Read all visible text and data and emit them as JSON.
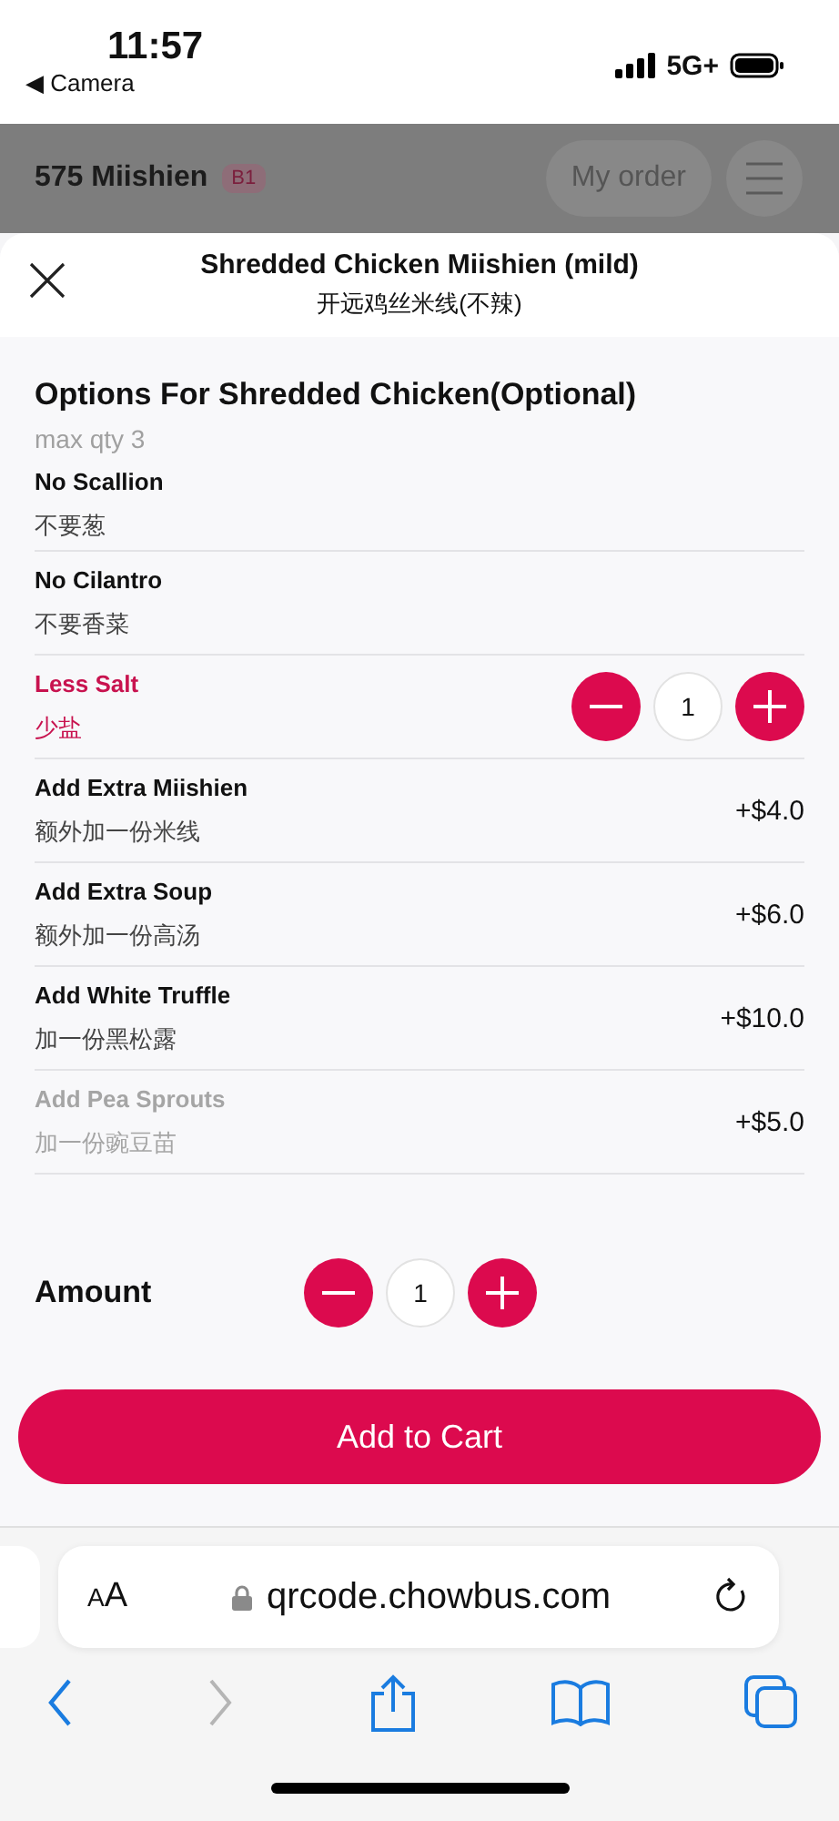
{
  "status_bar": {
    "time": "11:57",
    "back_label": "◀ Camera",
    "network": "5G+"
  },
  "header": {
    "restaurant": "575 Miishien",
    "table_badge": "B1",
    "my_order": "My order"
  },
  "sheet": {
    "title": "Shredded Chicken Miishien (mild)",
    "subtitle": "开远鸡丝米线(不辣)"
  },
  "options_group": {
    "title": "Options For Shredded Chicken(Optional)",
    "note": "max qty 3",
    "options": [
      {
        "kind": "plain",
        "name": "No Scallion",
        "name_cn": "不要葱",
        "selected": false,
        "disabled": false
      },
      {
        "kind": "plain",
        "name": "No Cilantro",
        "name_cn": "不要香菜",
        "selected": false,
        "disabled": false
      },
      {
        "kind": "stepper",
        "name": "Less Salt",
        "name_cn": "少盐",
        "selected": true,
        "disabled": false,
        "quantity": "1"
      },
      {
        "kind": "price",
        "name": "Add Extra Miishien",
        "name_cn": "额外加一份米线",
        "selected": false,
        "disabled": false,
        "price": "+$4.0"
      },
      {
        "kind": "price",
        "name": "Add Extra Soup",
        "name_cn": "额外加一份高汤",
        "selected": false,
        "disabled": false,
        "price": "+$6.0"
      },
      {
        "kind": "price",
        "name": "Add White Truffle",
        "name_cn": "加一份黑松露",
        "selected": false,
        "disabled": false,
        "price": "+$10.0"
      },
      {
        "kind": "price",
        "name": "Add Pea Sprouts",
        "name_cn": "加一份豌豆苗",
        "selected": false,
        "disabled": true,
        "price": "+$5.0"
      }
    ]
  },
  "amount": {
    "label": "Amount",
    "quantity": "1"
  },
  "add_to_cart": "Add to Cart",
  "browser": {
    "text_size": "AA",
    "url": "qrcode.chowbus.com"
  }
}
